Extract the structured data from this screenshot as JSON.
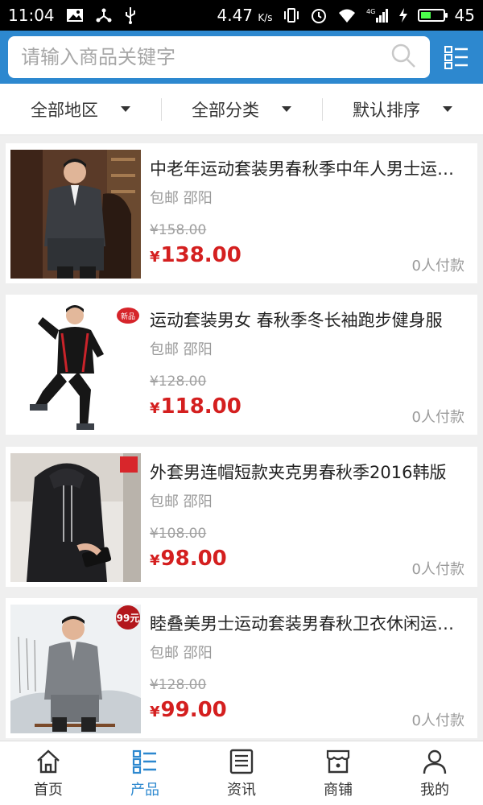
{
  "status_bar": {
    "time": "11:04",
    "network_speed": "4.47",
    "network_unit": "K/s",
    "battery": "45",
    "battery_level": 0.45,
    "signal_label": "4G"
  },
  "search": {
    "placeholder": "请输入商品关键字",
    "value": ""
  },
  "filters": [
    {
      "label": "全部地区"
    },
    {
      "label": "全部分类"
    },
    {
      "label": "默认排序"
    }
  ],
  "products": [
    {
      "title": "中老年运动套装男春秋季中年人男士运动服",
      "shipping": "包邮",
      "location": "邵阳",
      "old_price": "¥158.00",
      "currency": "¥",
      "price": "138.00",
      "sales": "0人付款"
    },
    {
      "title": "运动套装男女 春秋季冬长袖跑步健身服",
      "shipping": "包邮",
      "location": "邵阳",
      "old_price": "¥128.00",
      "currency": "¥",
      "price": "118.00",
      "sales": "0人付款"
    },
    {
      "title": "外套男连帽短款夹克男春秋季2016韩版",
      "shipping": "包邮",
      "location": "邵阳",
      "old_price": "¥108.00",
      "currency": "¥",
      "price": "98.00",
      "sales": "0人付款"
    },
    {
      "title": "睦叠美男士运动套装男春秋卫衣休闲运动服",
      "shipping": "包邮",
      "location": "邵阳",
      "old_price": "¥128.00",
      "currency": "¥",
      "price": "99.00",
      "sales": "0人付款"
    }
  ],
  "thumb_badges": {
    "p2": "新品",
    "p4": "99元"
  },
  "tabs": [
    {
      "label": "首页",
      "icon": "home-icon",
      "active": false
    },
    {
      "label": "产品",
      "icon": "list-icon",
      "active": true
    },
    {
      "label": "资讯",
      "icon": "news-icon",
      "active": false
    },
    {
      "label": "商铺",
      "icon": "store-icon",
      "active": false
    },
    {
      "label": "我的",
      "icon": "user-icon",
      "active": false
    }
  ],
  "colors": {
    "header": "#2d88cf",
    "price": "#d41f1f",
    "active_tab": "#2d88cf"
  }
}
